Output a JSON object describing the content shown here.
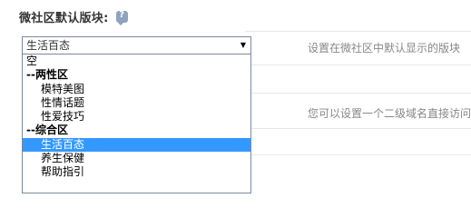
{
  "section": {
    "label": "微社区默认版块:",
    "help_icon": "help-bubble-icon"
  },
  "select": {
    "value": "生活百态",
    "arrow": "▼",
    "options": [
      {
        "label": "空",
        "kind": "option"
      },
      {
        "label": "--两性区",
        "kind": "group"
      },
      {
        "label": "模特美图",
        "kind": "child"
      },
      {
        "label": "性情话题",
        "kind": "child"
      },
      {
        "label": "性爱技巧",
        "kind": "child"
      },
      {
        "label": "--综合区",
        "kind": "group"
      },
      {
        "label": "生活百态",
        "kind": "child",
        "selected": true
      },
      {
        "label": "养生保健",
        "kind": "child"
      },
      {
        "label": "帮助指引",
        "kind": "child"
      }
    ]
  },
  "descriptions": {
    "default_board": "设置在微社区中默认显示的版块",
    "subdomain": "您可以设置一个二级域名直接访问"
  },
  "colors": {
    "selected_bg": "#3399ff",
    "desc_text": "#888888",
    "help_icon": "#8fa3bf"
  }
}
